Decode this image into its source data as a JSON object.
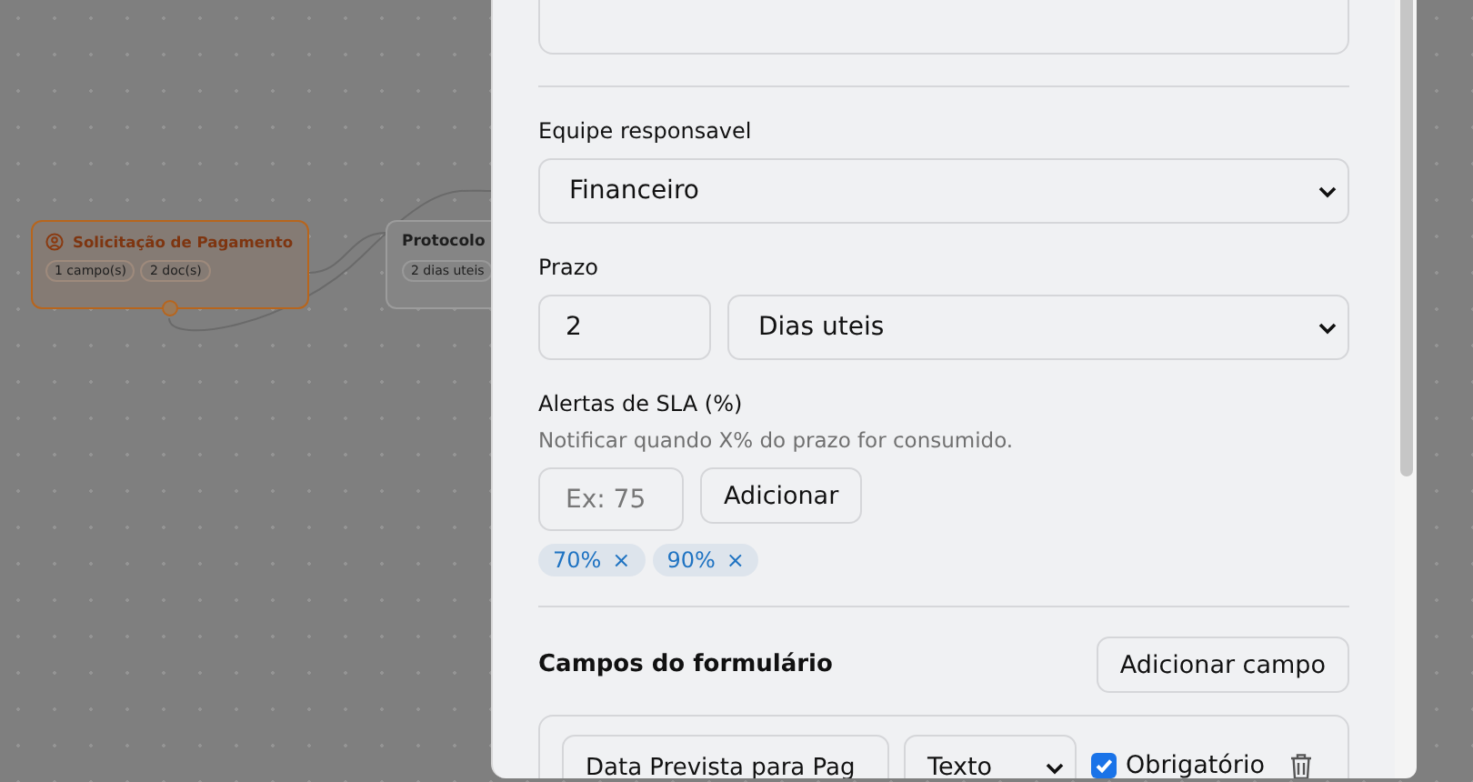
{
  "canvas": {
    "nodes": [
      {
        "title": "Solicitação de Pagamento",
        "selected": true,
        "badges": [
          "1 campo(s)",
          "2 doc(s)"
        ]
      },
      {
        "title": "Protocolo",
        "selected": false,
        "badges": [
          "2 dias uteis"
        ]
      }
    ]
  },
  "panel": {
    "team": {
      "label": "Equipe responsavel",
      "value": "Financeiro"
    },
    "deadline": {
      "label": "Prazo",
      "amount": "2",
      "unit": "Dias uteis"
    },
    "sla": {
      "label": "Alertas de SLA (%)",
      "hint": "Notificar quando X% do prazo for consumido.",
      "placeholder": "Ex: 75",
      "add_button": "Adicionar",
      "alerts": [
        {
          "value": "70%",
          "remove": "×"
        },
        {
          "value": "90%",
          "remove": "×"
        }
      ]
    },
    "fields": {
      "title": "Campos do formulário",
      "add_button": "Adicionar campo",
      "items": [
        {
          "name": "Data Prevista para Pag",
          "type": "Texto",
          "required": true,
          "required_label": "Obrigatório"
        }
      ]
    }
  }
}
